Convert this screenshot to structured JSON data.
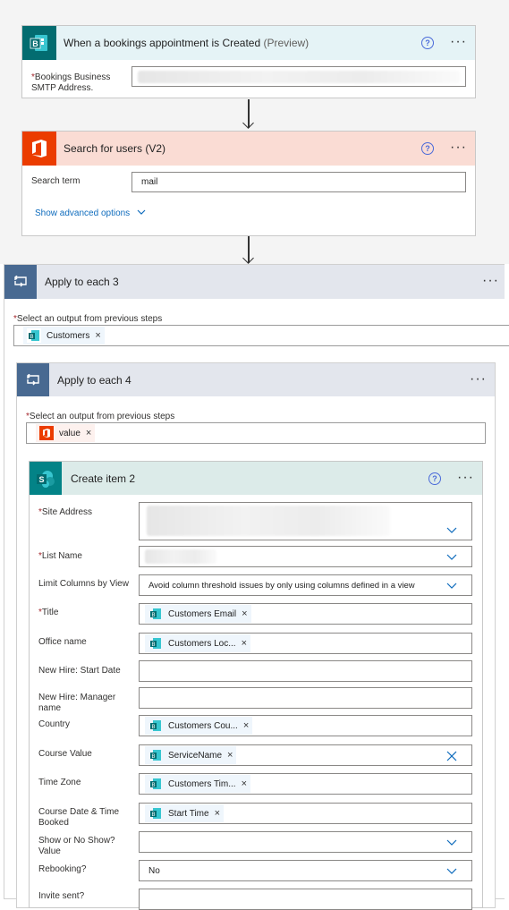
{
  "trigger": {
    "title": "When a bookings appointment is Created",
    "title_suffix": "(Preview)",
    "tile_letter": "B",
    "field_label_line1": "Bookings Business",
    "field_label_line2": "SMTP Address.",
    "required_mark": "*"
  },
  "search_users": {
    "title": "Search for users (V2)",
    "search_term_label": "Search term",
    "search_term_value": "mail",
    "advanced_link": "Show advanced options"
  },
  "apply_each_3": {
    "title": "Apply to each 3",
    "select_label": "Select an output from previous steps",
    "token": "Customers"
  },
  "apply_each_4": {
    "title": "Apply to each 4",
    "select_label": "Select an output from previous steps",
    "token": "value"
  },
  "create_item": {
    "title": "Create item 2",
    "tile_letter": "S",
    "fields": {
      "site_address": "Site Address",
      "list_name": "List Name",
      "limit_columns": "Limit Columns by View",
      "limit_columns_value": "Avoid column threshold issues by only using columns defined in a view",
      "title": "Title",
      "title_token": "Customers Email",
      "office_name": "Office name",
      "office_token": "Customers Loc...",
      "new_hire_start": "New Hire: Start Date",
      "new_hire_manager_1": "New Hire: Manager",
      "new_hire_manager_2": "name",
      "country": "Country",
      "country_token": "Customers Cou...",
      "course_value": "Course Value",
      "course_token": "ServiceName",
      "time_zone": "Time Zone",
      "time_zone_token": "Customers Tim...",
      "course_date_1": "Course Date & Time",
      "course_date_2": "Booked",
      "course_date_token": "Start Time",
      "show_no_show_1": "Show or No Show?",
      "show_no_show_2": "Value",
      "rebooking": "Rebooking?",
      "rebooking_value": "No",
      "cut_off": "Invite sent?"
    }
  },
  "common": {
    "required_mark": "*",
    "token_close": "×",
    "more_glyph": "···",
    "help_glyph": "?"
  },
  "colors": {
    "bookings": "#036c70",
    "office_red": "#eb3c00",
    "loop_blue": "#486991",
    "sharepoint": "#038387"
  }
}
